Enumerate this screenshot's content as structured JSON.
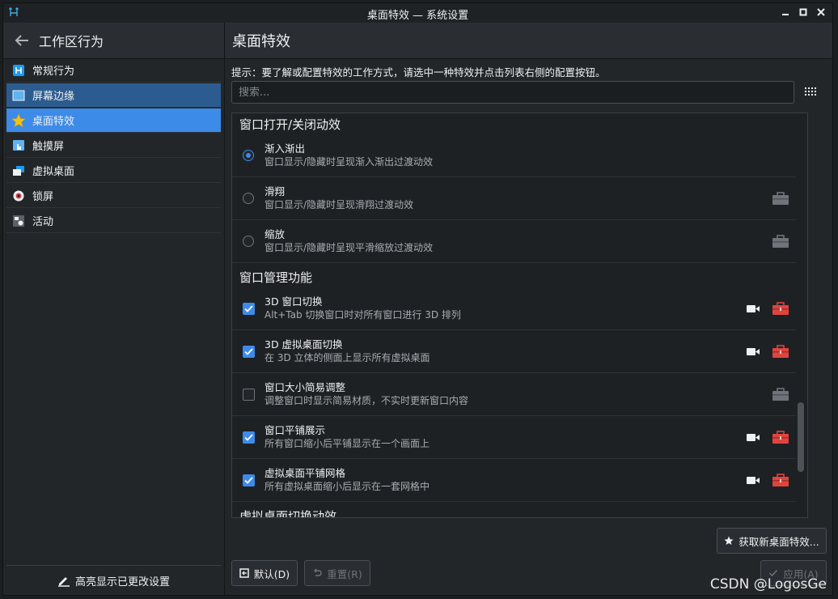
{
  "window": {
    "title": "桌面特效 — 系统设置"
  },
  "sidebar": {
    "header": "工作区行为",
    "items": [
      {
        "label": "常规行为",
        "icon": "general-behavior-icon"
      },
      {
        "label": "屏幕边缘",
        "icon": "screen-edges-icon"
      },
      {
        "label": "桌面特效",
        "icon": "star-icon"
      },
      {
        "label": "触摸屏",
        "icon": "touchscreen-icon"
      },
      {
        "label": "虚拟桌面",
        "icon": "virtual-desktops-icon"
      },
      {
        "label": "锁屏",
        "icon": "lock-screen-icon"
      },
      {
        "label": "活动",
        "icon": "activities-icon"
      }
    ],
    "footer": "高亮显示已更改设置"
  },
  "main": {
    "title": "桌面特效",
    "hint": "提示：要了解或配置特效的工作方式，请选中一种特效并点击列表右侧的配置按钮。",
    "search_placeholder": "搜索...",
    "categories": [
      {
        "name": "窗口打开/关闭动效"
      },
      {
        "name": "窗口管理功能"
      },
      {
        "name": "虚拟桌面切换动效"
      }
    ],
    "effects": [
      {
        "name": "渐入渐出",
        "desc": "窗口显示/隐藏时呈现渐入渐出过渡动效",
        "selected": true
      },
      {
        "name": "滑翔",
        "desc": "窗口显示/隐藏时呈现滑翔过渡动效",
        "selected": false
      },
      {
        "name": "缩放",
        "desc": "窗口显示/隐藏时呈现平滑缩放过渡动效",
        "selected": false
      },
      {
        "name": "3D 窗口切换",
        "desc": "Alt+Tab 切换窗口时对所有窗口进行 3D 排列",
        "checked": true
      },
      {
        "name": "3D 虚拟桌面切换",
        "desc": "在 3D 立体的侧面上显示所有虚拟桌面",
        "checked": true
      },
      {
        "name": "窗口大小简易调整",
        "desc": "调整窗口时显示简易材质，不实时更新窗口内容",
        "checked": false
      },
      {
        "name": "窗口平铺展示",
        "desc": "所有窗口缩小后平铺显示在一个画面上",
        "checked": true
      },
      {
        "name": "虚拟桌面平铺网格",
        "desc": "所有虚拟桌面缩小后显示在一套网格中",
        "checked": true
      }
    ],
    "get_new_label": "获取新桌面特效...",
    "default_label": "默认(D)",
    "reset_label": "重置(R)",
    "apply_label": "应用(A)"
  },
  "watermark": "CSDN @LogosGe",
  "colors": {
    "accent": "#3d8be8",
    "hover": "#2c5c8f",
    "config_active": "#e0443e",
    "background": "#232629"
  }
}
